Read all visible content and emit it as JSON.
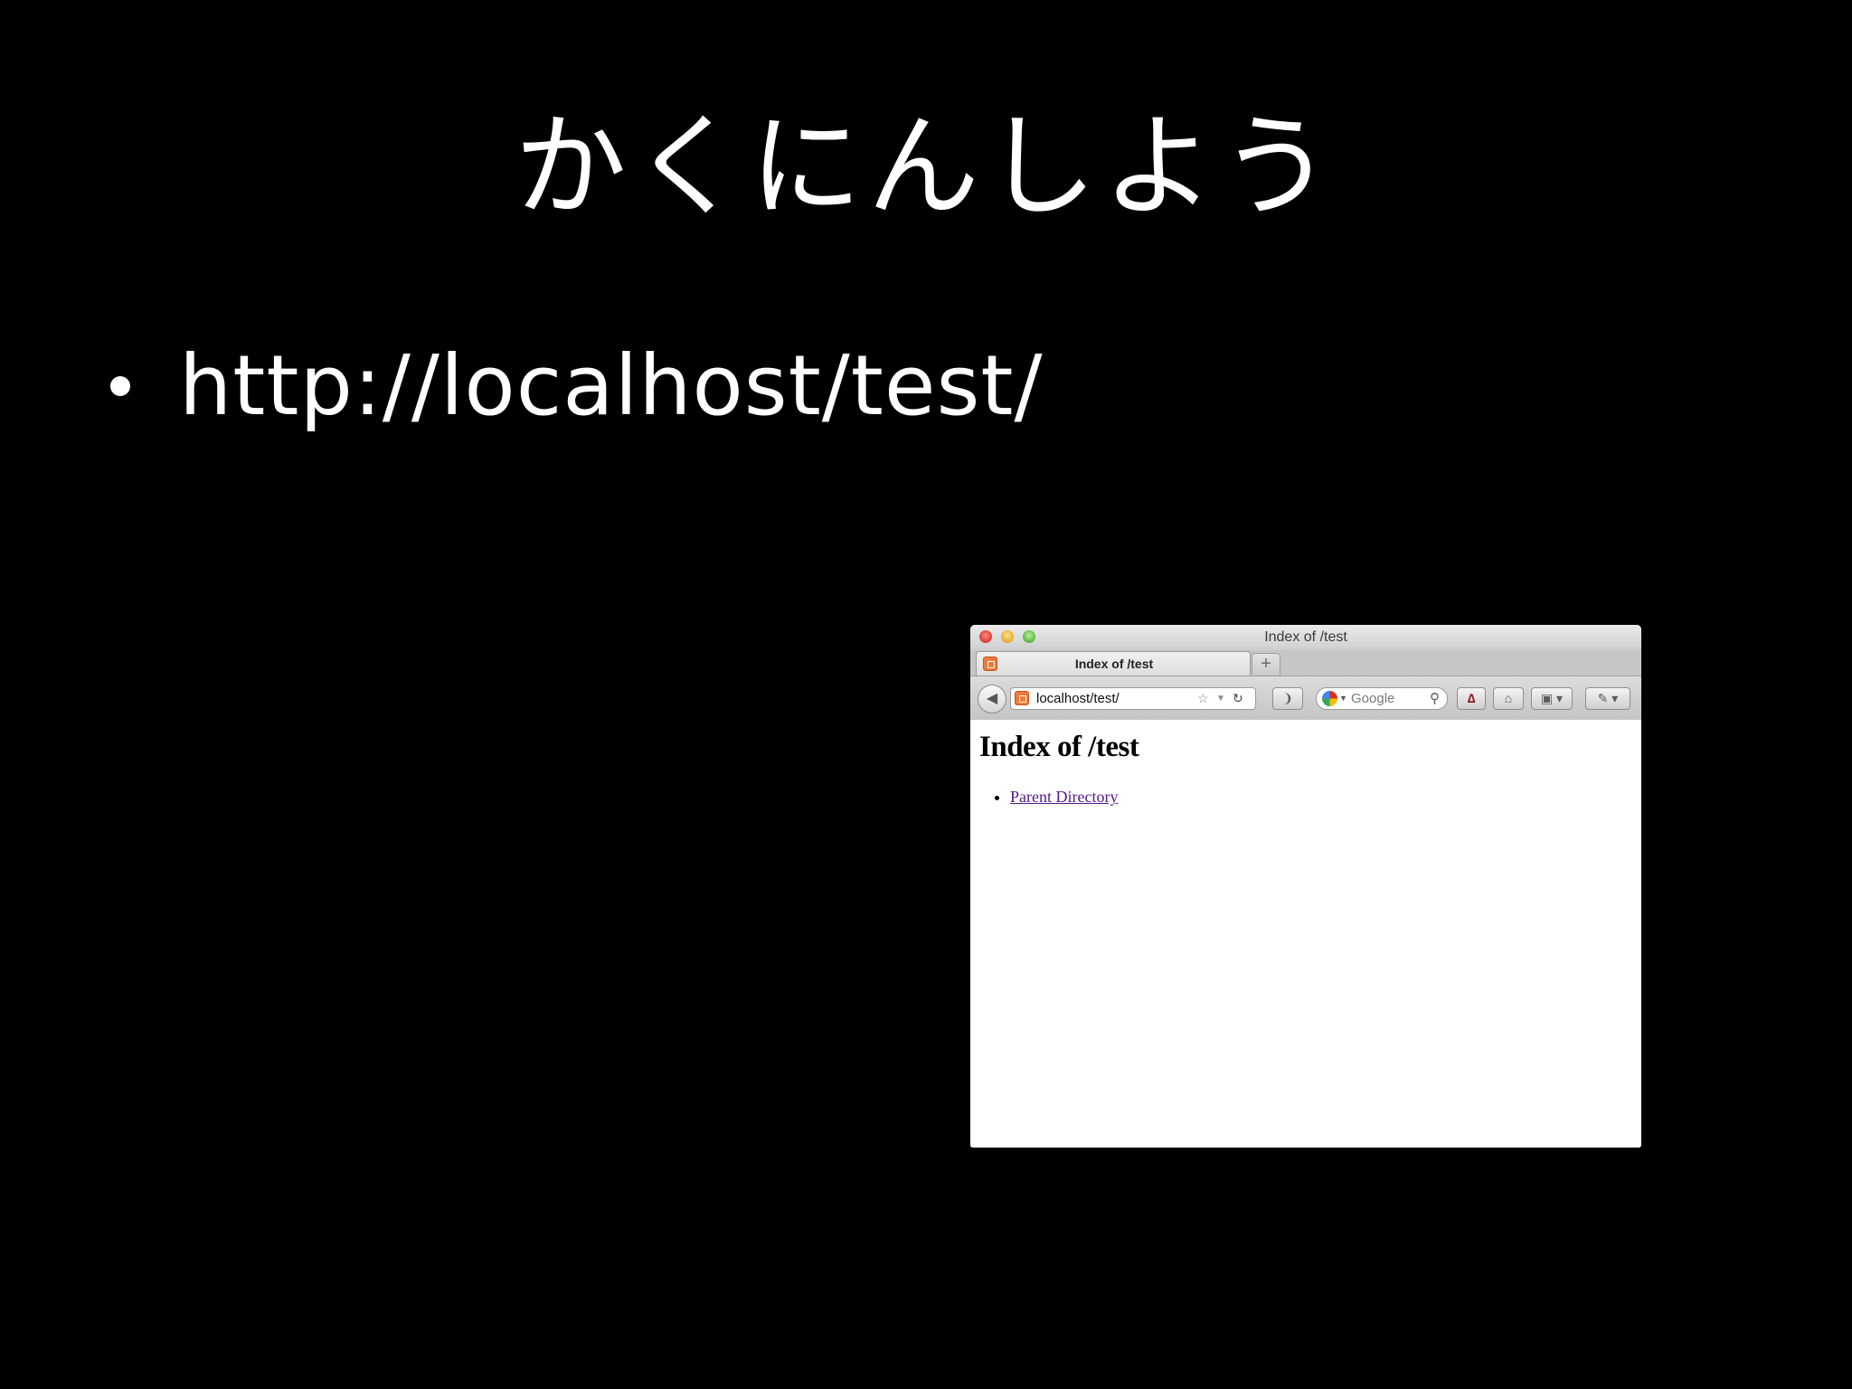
{
  "slide": {
    "title": "かくにんしよう",
    "bullets": [
      "http://localhost/test/"
    ]
  },
  "browser": {
    "window_title": "Index of /test",
    "tab_label": "Index of /test",
    "new_tab_symbol": "+",
    "url": "localhost/test/",
    "search_placeholder": "Google",
    "page": {
      "heading": "Index of /test",
      "links": [
        "Parent Directory"
      ]
    }
  },
  "colors": {
    "slide_background": "#000000",
    "slide_text": "#ffffff",
    "visited_link": "#551a8b"
  },
  "icons": {
    "back": "back-arrow-icon",
    "bookmark": "star-icon",
    "reload": "reload-icon",
    "rss": "rss-icon",
    "search": "magnifier-icon",
    "home": "home-icon",
    "bookmarks": "bookmarks-icon",
    "addon": "puzzle-icon"
  }
}
